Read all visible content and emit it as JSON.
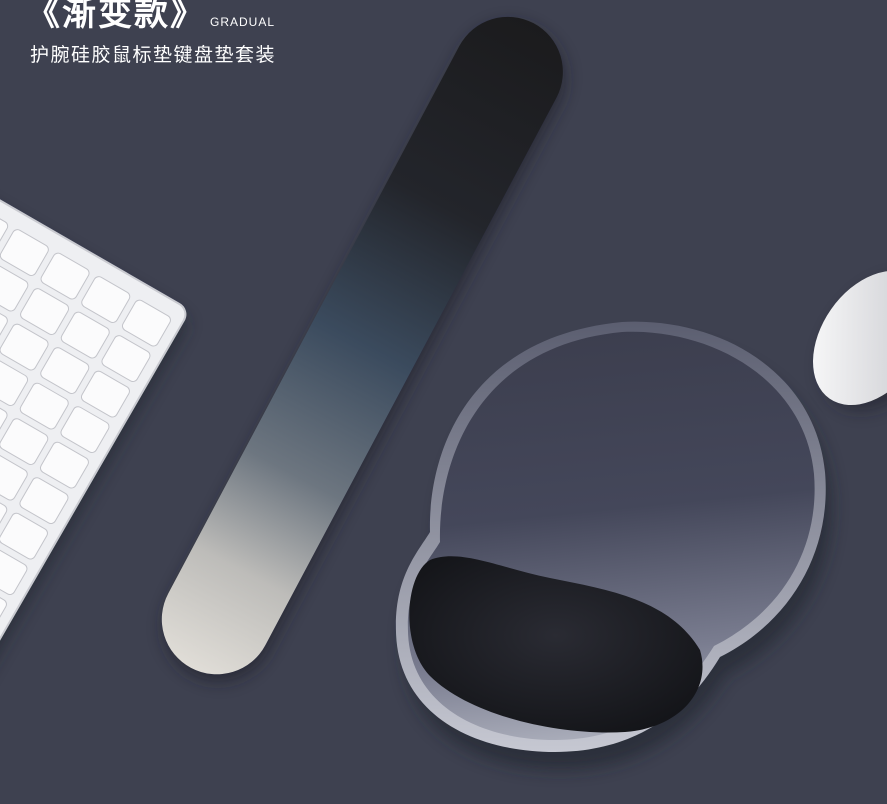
{
  "header": {
    "title": "《渐变款》",
    "title_en": "GRADUAL",
    "subtitle": "护腕硅胶鼠标垫键盘垫套装"
  },
  "colors": {
    "background": "#3e4150",
    "wrist_rest_top": "#1c1c1e",
    "wrist_rest_mid": "#3a4a5c",
    "wrist_rest_bottom": "#dedcd6",
    "mousepad": "#4a4d5e",
    "mousepad_rest": "#1e1f26",
    "keyboard": "#f4f4f6",
    "mouse": "#e8e8ea"
  },
  "objects": [
    "keyboard",
    "gradient-wrist-rest",
    "mouse-pad-with-wrist-support",
    "mouse"
  ]
}
